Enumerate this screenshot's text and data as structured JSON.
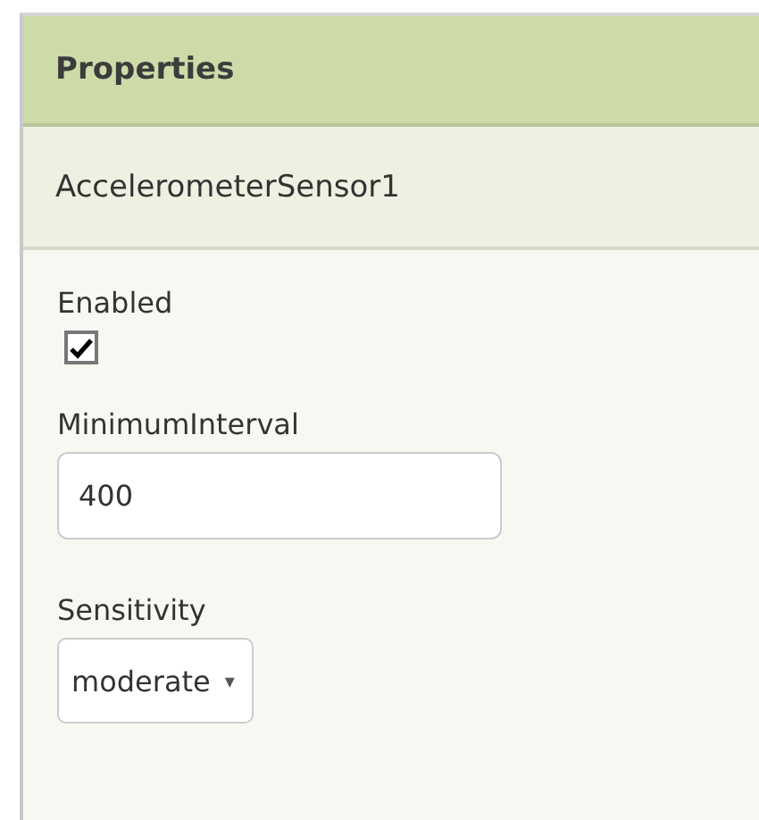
{
  "panel": {
    "title": "Properties",
    "component": "AccelerometerSensor1"
  },
  "properties": [
    {
      "kind": "checkbox",
      "label": "Enabled",
      "checked": true
    },
    {
      "kind": "text",
      "label": "MinimumInterval",
      "value": "400"
    },
    {
      "kind": "dropdown",
      "label": "Sensitivity",
      "value": "moderate",
      "arrow": "▾"
    }
  ]
}
